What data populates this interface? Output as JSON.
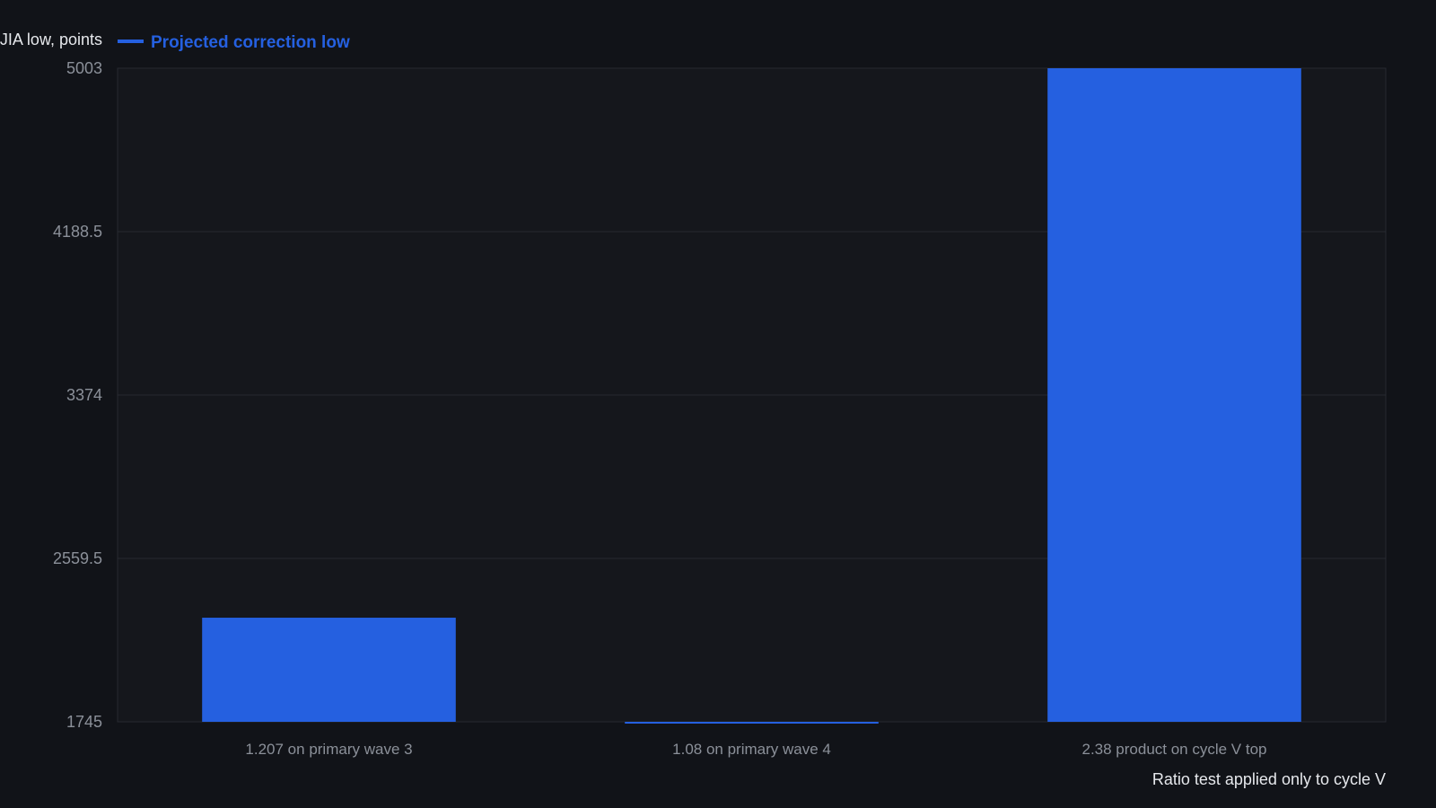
{
  "chart_data": {
    "type": "bar",
    "title": "",
    "ylabel": "DJIA low, points",
    "xlabel": "",
    "categories": [
      "1.207 on primary wave 3",
      "1.08 on primary wave 4",
      "2.38 product on cycle V top"
    ],
    "series": [
      {
        "name": "Projected correction low",
        "values": [
          2264,
          1741,
          5003
        ],
        "color": "#2560e0"
      }
    ],
    "ylim": [
      1745,
      5003
    ],
    "yticks": [
      "1745",
      "2559.5",
      "3374",
      "4188.5",
      "5003"
    ],
    "grid": true,
    "legend_position": "top-left",
    "annotation": "Ratio test applied only to cycle V"
  },
  "colors": {
    "background": "#111318",
    "plot_background": "#15171c",
    "grid": "#262a31",
    "axis_text": "#8b9099",
    "accent": "#2560e0"
  }
}
